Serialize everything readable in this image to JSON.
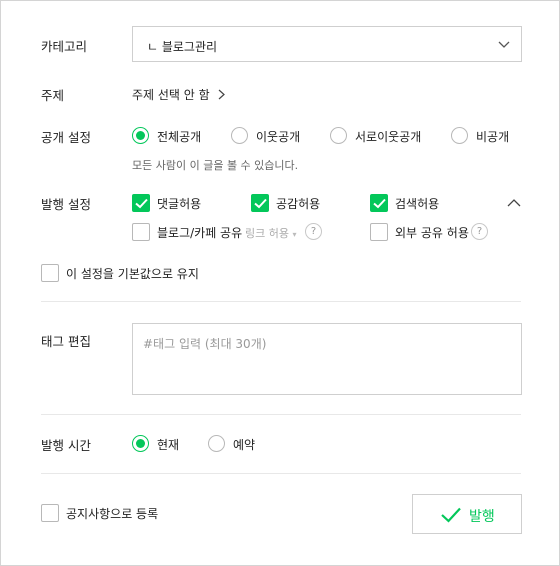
{
  "category": {
    "label": "카테고리",
    "selected": "ㄴ  블로그관리"
  },
  "topic": {
    "label": "주제",
    "value": "주제 선택 안 함"
  },
  "visibility": {
    "label": "공개 설정",
    "options": [
      "전체공개",
      "이웃공개",
      "서로이웃공개",
      "비공개"
    ],
    "selected": "전체공개",
    "note": "모든 사람이 이 글을 볼 수 있습니다."
  },
  "publish_settings": {
    "label": "발행 설정",
    "comments": "댓글허용",
    "likes": "공감허용",
    "search": "검색허용",
    "share": "블로그/카페 공유",
    "link_allow": "링크 허용",
    "external_share": "외부 공유 허용",
    "help": "?"
  },
  "default_setting": "이 설정을 기본값으로 유지",
  "tags": {
    "label": "태그 편집",
    "placeholder": "#태그 입력 (최대 30개)"
  },
  "publish_time": {
    "label": "발행 시간",
    "now": "현재",
    "reserve": "예약"
  },
  "notice": "공지사항으로 등록",
  "publish_button": "발행",
  "colors": {
    "accent": "#03c75a",
    "border": "#cfcfcf"
  }
}
